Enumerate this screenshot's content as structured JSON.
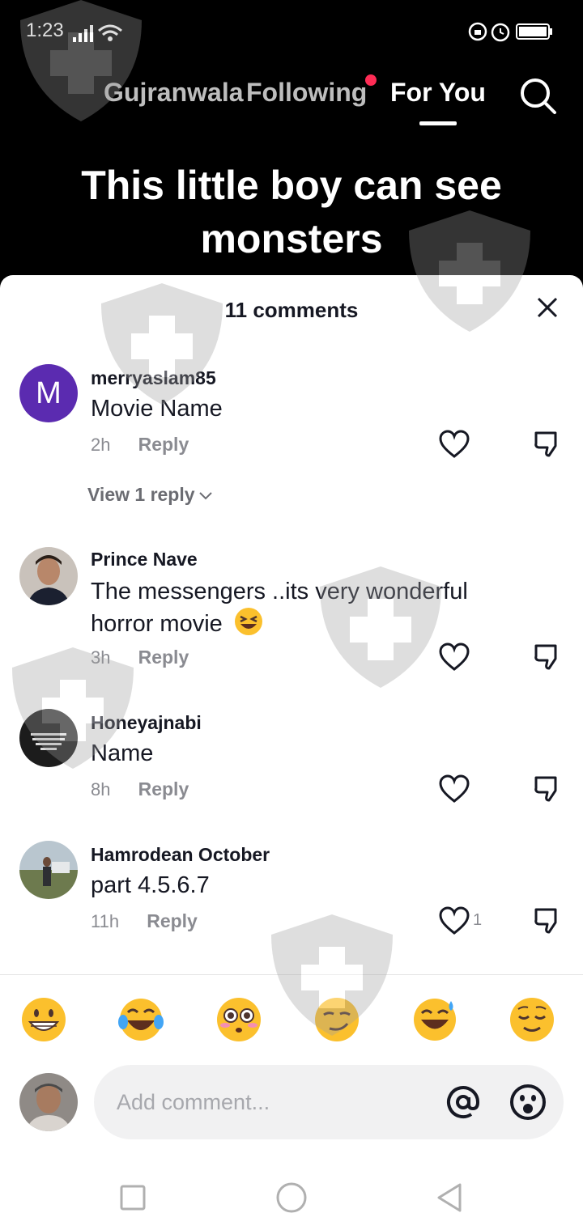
{
  "status_bar": {
    "time": "1:23"
  },
  "nav": {
    "tabs": [
      {
        "label": "Gujranwala"
      },
      {
        "label": "Following"
      },
      {
        "label": "For You"
      }
    ],
    "active_tab": "For You"
  },
  "video": {
    "caption_line1": "This little boy can see",
    "caption_line2": "monsters"
  },
  "comments_sheet": {
    "title": "11 comments",
    "comments": [
      {
        "user": "merryaslam85",
        "avatar_letter": "M",
        "text": "Movie Name",
        "time": "2h",
        "reply_label": "Reply",
        "likes": "",
        "view_replies": "View 1 reply"
      },
      {
        "user": "Prince Nave",
        "text_line1": "The messengers ..its very wonderful",
        "text_line2": "horror movie",
        "time": "3h",
        "reply_label": "Reply",
        "likes": ""
      },
      {
        "user": "Honeyajnabi",
        "text": "Name",
        "time": "8h",
        "reply_label": "Reply",
        "likes": ""
      },
      {
        "user": "Hamrodean October",
        "text": "part 4.5.6.7",
        "time": "11h",
        "reply_label": "Reply",
        "likes": "1"
      }
    ],
    "emoji_icons": [
      "grinning-face-icon",
      "tears-of-joy-icon",
      "flushed-face-icon",
      "smirking-face-icon",
      "sweat-smile-icon",
      "relieved-face-icon"
    ],
    "input": {
      "placeholder": "Add comment..."
    }
  },
  "colors": {
    "accent": "#fe2c55",
    "text": "#161823",
    "muted": "#8a8b91",
    "avatar_m": "#5b2bb0"
  }
}
